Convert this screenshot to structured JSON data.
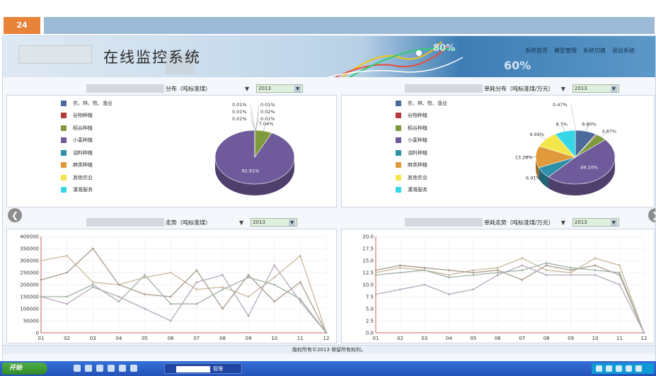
{
  "slide": {
    "number": "24"
  },
  "banner": {
    "title": "在线监控系统",
    "nav": [
      "系统首页",
      "模型管理",
      "系统切换",
      "退出系统"
    ],
    "deco_text": [
      "80%",
      "60%"
    ]
  },
  "panels": {
    "pie_left": {
      "title": "分布（吨标准煤）",
      "marker": "▼",
      "select": "2013"
    },
    "pie_right": {
      "title": "单耗分布（吨标准煤/万元）",
      "marker": "▼",
      "select": "2013"
    },
    "line_left": {
      "title": "走势（吨标准煤）",
      "marker": "▼",
      "select": "2013"
    },
    "line_right": {
      "title": "单耗走势（吨标准煤/万元）",
      "marker": "▼",
      "select": "2013"
    }
  },
  "legend": [
    {
      "label": "农、林、牧、渔业",
      "color": "#4a6a9c"
    },
    {
      "label": "谷物种植",
      "color": "#b23a3a"
    },
    {
      "label": "稻谷种植",
      "color": "#7f9a3c"
    },
    {
      "label": "小麦种植",
      "color": "#6f5a9b"
    },
    {
      "label": "油料种植",
      "color": "#2e8fa8"
    },
    {
      "label": "麻类种植",
      "color": "#e09a3c"
    },
    {
      "label": "其他农业",
      "color": "#f2e64a"
    },
    {
      "label": "灌溉服务",
      "color": "#36d6e6"
    }
  ],
  "nav_buttons": {
    "left": "❮",
    "right": "❯"
  },
  "status_text": "版权所有©2013 保留所有权利。",
  "taskbar": {
    "start_label": "开始",
    "task_label": "管理"
  },
  "chart_data": [
    {
      "type": "pie",
      "title": "分布（吨标准煤）",
      "slices": [
        {
          "name": "农、林、牧、渔业",
          "value": 0.01,
          "label": "0.01%"
        },
        {
          "name": "谷物种植",
          "value": 0.01,
          "label": "0.01%"
        },
        {
          "name": "稻谷种植",
          "value": 7.04,
          "label": "7.04%"
        },
        {
          "name": "小麦种植",
          "value": 92.91,
          "label": "92.91%"
        },
        {
          "name": "油料种植",
          "value": 0.01,
          "label": "0.01%"
        },
        {
          "name": "麻类种植",
          "value": 0.02,
          "label": "0.02%"
        },
        {
          "name": "其他农业",
          "value": 0.01,
          "label": "0.01%"
        },
        {
          "name": "灌溉服务",
          "value": 0.01,
          "label": "0.01%"
        }
      ]
    },
    {
      "type": "pie",
      "title": "单耗分布（吨标准煤/万元）",
      "slices": [
        {
          "name": "农、林、牧、渔业",
          "value": 8.8,
          "label": "8.80%"
        },
        {
          "name": "谷物种植",
          "value": 0.47,
          "label": "0.47%"
        },
        {
          "name": "稻谷种植",
          "value": 4.67,
          "label": "4.67%"
        },
        {
          "name": "小麦种植",
          "value": 49.1,
          "label": "49.10%"
        },
        {
          "name": "油料种植",
          "value": 6.91,
          "label": "6.91%"
        },
        {
          "name": "麻类种植",
          "value": 13.28,
          "label": "13.28%"
        },
        {
          "name": "其他农业",
          "value": 9.93,
          "label": "9.93%"
        },
        {
          "name": "灌溉服务",
          "value": 8.7,
          "label": "8.7%"
        }
      ]
    },
    {
      "type": "line",
      "title": "走势（吨标准煤）",
      "categories": [
        "01",
        "02",
        "03",
        "04",
        "05",
        "06",
        "07",
        "08",
        "09",
        "10",
        "11",
        "12"
      ],
      "yticks": [
        "0",
        "50000",
        "100000",
        "150000",
        "200000",
        "250000",
        "300000",
        "350000",
        "400000"
      ],
      "ylim": [
        0,
        400000
      ],
      "grid": true,
      "series": [
        {
          "color": "#c8b89a",
          "values": [
            300000,
            320000,
            210000,
            200000,
            230000,
            250000,
            180000,
            190000,
            150000,
            230000,
            320000,
            0
          ]
        },
        {
          "color": "#a89a8a",
          "values": [
            220000,
            250000,
            350000,
            200000,
            160000,
            150000,
            260000,
            100000,
            240000,
            130000,
            210000,
            0
          ]
        },
        {
          "color": "#b7a7bd",
          "values": [
            150000,
            120000,
            190000,
            150000,
            100000,
            50000,
            210000,
            240000,
            70000,
            280000,
            130000,
            0
          ]
        },
        {
          "color": "#9fb0a4",
          "values": [
            150000,
            150000,
            200000,
            130000,
            240000,
            120000,
            120000,
            180000,
            230000,
            200000,
            140000,
            0
          ]
        }
      ]
    },
    {
      "type": "line",
      "title": "单耗走势（吨标准煤/万元）",
      "categories": [
        "01",
        "02",
        "03",
        "04",
        "05",
        "06",
        "07",
        "08",
        "09",
        "10",
        "11",
        "12"
      ],
      "yticks": [
        "0.0",
        "2.5",
        "5.0",
        "7.5",
        "10.0",
        "12.5",
        "15.0",
        "17.5",
        "20.0"
      ],
      "ylim": [
        0,
        20
      ],
      "grid": true,
      "series": [
        {
          "color": "#c8b89a",
          "values": [
            12.5,
            13.5,
            13.0,
            12.0,
            13.0,
            13.5,
            15.5,
            13.0,
            12.5,
            15.5,
            14.0,
            0
          ]
        },
        {
          "color": "#a89a8a",
          "values": [
            13.0,
            14.0,
            13.5,
            13.0,
            12.5,
            13.0,
            11.0,
            14.0,
            13.0,
            14.0,
            12.0,
            0
          ]
        },
        {
          "color": "#b7a7bd",
          "values": [
            8.0,
            9.0,
            10.0,
            8.0,
            9.0,
            12.0,
            14.0,
            12.0,
            12.0,
            12.0,
            10.0,
            0
          ]
        },
        {
          "color": "#9fb0a4",
          "values": [
            12.0,
            12.5,
            13.0,
            11.5,
            12.0,
            12.5,
            13.0,
            14.5,
            13.5,
            13.0,
            12.5,
            0
          ]
        }
      ]
    }
  ]
}
